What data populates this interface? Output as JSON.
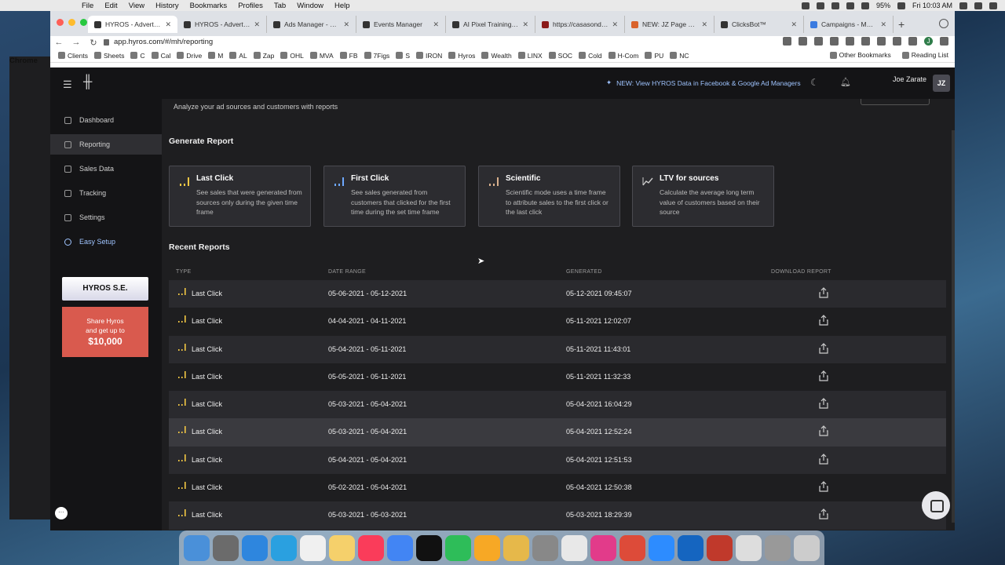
{
  "menubar": {
    "app": "Chrome",
    "items": [
      "File",
      "Edit",
      "View",
      "History",
      "Bookmarks",
      "Profiles",
      "Tab",
      "Window",
      "Help"
    ],
    "battery": "95%",
    "clock": "Fri 10:03 AM"
  },
  "browser": {
    "tabs": [
      {
        "title": "HYROS - Advertisin",
        "color": "#333"
      },
      {
        "title": "HYROS - Advertisin",
        "color": "#333"
      },
      {
        "title": "Ads Manager - Man",
        "color": "#333"
      },
      {
        "title": "Events Manager",
        "color": "#333"
      },
      {
        "title": "AI Pixel Training / Cl",
        "color": "#333"
      },
      {
        "title": "https://casasonden",
        "color": "#8b1a1a"
      },
      {
        "title": "NEW: JZ Page FB L",
        "color": "#d9622b"
      },
      {
        "title": "ClicksBot™",
        "color": "#333"
      },
      {
        "title": "Campaigns - MVA |",
        "color": "#3b7be0"
      }
    ],
    "url": "app.hyros.com/#/mh/reporting",
    "profile_initial": "J",
    "bookmarks": [
      "Clients",
      "Sheets",
      "C",
      "Cal",
      "Drive",
      "M",
      "AL",
      "Zap",
      "OHL",
      "MVA",
      "FB",
      "7Figs",
      "S",
      "IRON",
      "Hyros",
      "Wealth",
      "LINX",
      "SOC",
      "Cold",
      "H-Com",
      "PU",
      "NC"
    ],
    "other_bookmarks": "Other Bookmarks",
    "reading_list": "Reading List"
  },
  "header": {
    "announcement": "NEW: View HYROS Data in Facebook & Google Ad Managers",
    "user_name": "Joe Zarate",
    "user_initials": "JZ"
  },
  "sidebar": {
    "items": [
      {
        "label": "Dashboard"
      },
      {
        "label": "Reporting"
      },
      {
        "label": "Sales Data"
      },
      {
        "label": "Tracking"
      },
      {
        "label": "Settings"
      },
      {
        "label": "Easy Setup"
      }
    ],
    "se_banner": "HYROS S.E.",
    "share_banner": {
      "line1": "Share Hyros",
      "line2": "and get up to",
      "amount": "$10,000"
    }
  },
  "page": {
    "subtitle": "Analyze your ad sources and customers with reports",
    "generate_title": "Generate Report",
    "recent_title": "Recent Reports"
  },
  "report_types": [
    {
      "title": "Last Click",
      "desc": "See sales that were generated from sources only during the given time frame",
      "icon": "bar-chart-icon",
      "accent": "#f2c744"
    },
    {
      "title": "First Click",
      "desc": "See sales generated from customers that clicked for the first time during the set time frame",
      "icon": "bar-chart-icon",
      "accent": "#6ea8ff"
    },
    {
      "title": "Scientific",
      "desc": "Scientific mode uses a time frame to attribute sales to the first click or the last click",
      "icon": "bar-chart-icon",
      "accent": "#d9b08c"
    },
    {
      "title": "LTV for sources",
      "desc": "Calculate the average long term value of customers based on their source",
      "icon": "trend-icon",
      "accent": "#cccccc"
    }
  ],
  "table": {
    "headers": {
      "type": "TYPE",
      "date_range": "DATE RANGE",
      "generated": "GENERATED",
      "download": "DOWNLOAD REPORT"
    },
    "rows": [
      {
        "type": "Last Click",
        "date_range": "05-06-2021 - 05-12-2021",
        "generated": "05-12-2021 09:45:07"
      },
      {
        "type": "Last Click",
        "date_range": "04-04-2021 - 04-11-2021",
        "generated": "05-11-2021 12:02:07"
      },
      {
        "type": "Last Click",
        "date_range": "05-04-2021 - 05-11-2021",
        "generated": "05-11-2021 11:43:01"
      },
      {
        "type": "Last Click",
        "date_range": "05-05-2021 - 05-11-2021",
        "generated": "05-11-2021 11:32:33"
      },
      {
        "type": "Last Click",
        "date_range": "05-03-2021 - 05-04-2021",
        "generated": "05-04-2021 16:04:29"
      },
      {
        "type": "Last Click",
        "date_range": "05-03-2021 - 05-04-2021",
        "generated": "05-04-2021 12:52:24"
      },
      {
        "type": "Last Click",
        "date_range": "05-04-2021 - 05-04-2021",
        "generated": "05-04-2021 12:51:53"
      },
      {
        "type": "Last Click",
        "date_range": "05-02-2021 - 05-04-2021",
        "generated": "05-04-2021 12:50:38"
      },
      {
        "type": "Last Click",
        "date_range": "05-03-2021 - 05-03-2021",
        "generated": "05-03-2021 18:29:39"
      }
    ]
  },
  "dock": [
    "#4a90d9",
    "#6b6b6b",
    "#2e86de",
    "#2aa0e0",
    "#f0f0f0",
    "#f5d06b",
    "#fa3c5a",
    "#4285f4",
    "#111111",
    "#2ebd59",
    "#f7a825",
    "#e6b84a",
    "#888888",
    "#e8e8e8",
    "#e23b8a",
    "#dd4b39",
    "#2d8cff",
    "#1565c0",
    "#c0392b",
    "#dddddd",
    "#999999",
    "#cccccc"
  ]
}
